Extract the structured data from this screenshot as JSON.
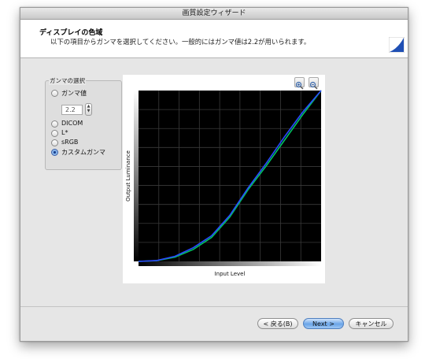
{
  "window": {
    "title": "画質設定ウィザード"
  },
  "header": {
    "title": "ディスプレイの色域",
    "subtitle": "以下の項目からガンマを選択してください。一般的にはガンマ値は2.2が用いられます。"
  },
  "gamma": {
    "group_title": "ガンマの選択",
    "options": [
      {
        "label": "ガンマ値",
        "selected": false
      },
      {
        "label": "DICOM",
        "selected": false
      },
      {
        "label": "L*",
        "selected": false
      },
      {
        "label": "sRGB",
        "selected": false
      },
      {
        "label": "カスタムガンマ",
        "selected": true
      }
    ],
    "value": "2.2"
  },
  "chart_data": {
    "type": "line",
    "xlabel": "Input Level",
    "ylabel": "Output Luminance",
    "xlim": [
      0,
      1
    ],
    "ylim": [
      0,
      1
    ],
    "grid": true,
    "series": [
      {
        "x": [
          0,
          0.1,
          0.2,
          0.3,
          0.4,
          0.5,
          0.6,
          0.7,
          0.8,
          0.9,
          1.0
        ],
        "values": [
          0,
          0.004,
          0.025,
          0.07,
          0.14,
          0.26,
          0.42,
          0.56,
          0.71,
          0.86,
          1.0
        ],
        "color": "#00c060"
      },
      {
        "x": [
          0,
          0.1,
          0.2,
          0.3,
          0.4,
          0.5,
          0.6,
          0.7,
          0.8,
          0.9,
          1.0
        ],
        "values": [
          0,
          0.005,
          0.03,
          0.08,
          0.15,
          0.27,
          0.43,
          0.575,
          0.73,
          0.875,
          1.0
        ],
        "color": "#2a48ff"
      }
    ]
  },
  "buttons": {
    "back": "< 戻る(B)",
    "next": "Next >",
    "cancel": "キャンセル"
  },
  "colors": {
    "accent": "#1f4fb4",
    "plot_bg": "#000000",
    "grid": "#3a3a3a"
  },
  "icons": {
    "zoom_in": "zoom-in-icon",
    "zoom_out": "zoom-out-icon"
  }
}
